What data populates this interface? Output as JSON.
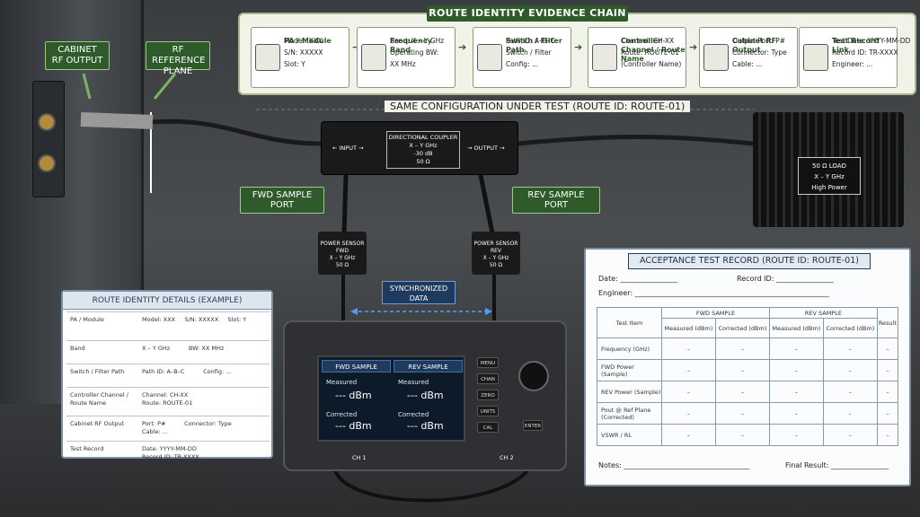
{
  "chain": {
    "title": "ROUTE IDENTITY EVIDENCE CHAIN",
    "cards": [
      {
        "h": "PA / Module",
        "lines": [
          "Model: XXX",
          "S/N: XXXXX",
          "Slot: Y"
        ]
      },
      {
        "h": "Frequency Band",
        "lines": [
          "Band: X – Y GHz",
          "Operating BW:",
          "XX MHz"
        ]
      },
      {
        "h": "Switch / Filter Path",
        "lines": [
          "Path ID: A–B–C",
          "Switch / Filter",
          "Config: ..."
        ]
      },
      {
        "h": "Controller Channel / Route Name",
        "lines": [
          "Channel: CH-XX",
          "Route: ROUTE-01",
          "(Controller Name)"
        ]
      },
      {
        "h": "Cabinet RF Output",
        "lines": [
          "Output Port: P#",
          "Connector: Type",
          "Cable: ..."
        ]
      },
      {
        "h": "Test Record Link",
        "lines": [
          "Test Date: YYYY-MM-DD",
          "Record ID: TR-XXXX",
          "Engineer: ..."
        ]
      }
    ],
    "same_config": "SAME CONFIGURATION UNDER TEST (ROUTE ID: ROUTE-01)"
  },
  "labels": {
    "cabinet_rf_output": "CABINET RF OUTPUT",
    "rf_reference_plane": "RF REFERENCE PLANE",
    "fwd_sample_port": "FWD SAMPLE PORT",
    "rev_sample_port": "REV SAMPLE PORT",
    "synchronized_data": "SYNCHRONIZED DATA"
  },
  "coupler": {
    "input": "← INPUT →",
    "output": "→ OUTPUT →",
    "title": "DIRECTIONAL COUPLER",
    "freq": "X – Y GHz",
    "coupling": "-30 dB",
    "imp": "50 Ω"
  },
  "load": {
    "l1": "50 Ω LOAD",
    "l2": "X – Y GHz",
    "l3": "High Power"
  },
  "sensors": [
    {
      "title": "POWER SENSOR",
      "dir": "FWD",
      "freq": "X – Y GHz",
      "imp": "50 Ω"
    },
    {
      "title": "POWER SENSOR",
      "dir": "REV",
      "freq": "X – Y GHz",
      "imp": "50 Ω"
    }
  ],
  "meter": {
    "fwd_header": "FWD SAMPLE",
    "rev_header": "REV SAMPLE",
    "measured": "Measured",
    "corrected": "Corrected",
    "value": "--- dBm",
    "buttons": [
      "MENU",
      "CHAN",
      "ZERO",
      "UNITS",
      "CAL"
    ],
    "enter": "ENTER",
    "ch1": "CH 1",
    "ch2": "CH 2"
  },
  "route_identity": {
    "title": "ROUTE IDENTITY DETAILS (EXAMPLE)",
    "rows": [
      {
        "k": "PA / Module",
        "v": "Model: XXX     S/N: XXXXX     Slot: Y"
      },
      {
        "k": "Band",
        "v": "X – Y GHz          BW: XX MHz"
      },
      {
        "k": "Switch / Filter Path",
        "v": "Path ID: A–B–C          Config: ..."
      },
      {
        "k": "Controller Channel / Route Name",
        "v": "Channel: CH-XX\nRoute: ROUTE-01"
      },
      {
        "k": "Cabinet RF Output",
        "v": "Port: P#          Connector: Type\nCable: ..."
      },
      {
        "k": "Test Record",
        "v": "Date: YYYY-MM-DD\nRecord ID: TR-XXXX\nEngineer: ..."
      }
    ]
  },
  "acceptance": {
    "title": "ACCEPTANCE TEST RECORD (ROUTE ID: ROUTE-01)",
    "date": "Date: ________________",
    "record_id": "Record ID: ________________",
    "engineer": "Engineer: ______________________________________________________",
    "col_item": "Test Item",
    "col_fwd": "FWD SAMPLE",
    "col_rev": "REV SAMPLE",
    "col_measured": "Measured (dBm)",
    "col_corrected": "Corrected (dBm)",
    "col_result": "Result",
    "rows": [
      "Frequency (GHz)",
      "FWD Power (Sample)",
      "REV Power (Sample)",
      "Pout @ Ref Plane (Corrected)",
      "VSWR / RL"
    ],
    "dash": "–",
    "notes": "Notes: ___________________________________",
    "final": "Final Result: ________________"
  }
}
